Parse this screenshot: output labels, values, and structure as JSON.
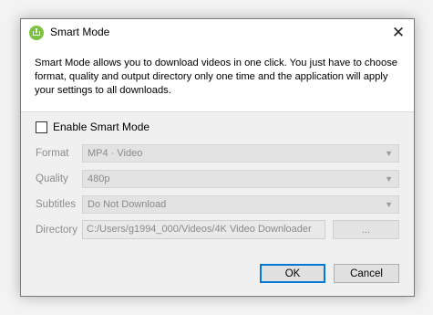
{
  "dialog": {
    "title": "Smart Mode",
    "close_glyph": "✕",
    "description": "Smart Mode allows you to download videos in one click. You just have to choose format, quality and output directory only one time and the application will apply your settings to all downloads."
  },
  "smart_mode": {
    "checkbox_label": "Enable Smart Mode",
    "checked": false
  },
  "fields": {
    "format": {
      "label": "Format",
      "value": "MP4 · Video"
    },
    "quality": {
      "label": "Quality",
      "value": "480p"
    },
    "subtitles": {
      "label": "Subtitles",
      "value": "Do Not Download"
    },
    "directory": {
      "label": "Directory",
      "value": "C:/Users/g1994_000/Videos/4K Video Downloader"
    }
  },
  "buttons": {
    "browse": "...",
    "ok": "OK",
    "cancel": "Cancel"
  },
  "colors": {
    "app_icon": "#7cc242",
    "default_button_border": "#0078d7",
    "disabled_text": "#8a8a8a"
  },
  "icons": {
    "app": "4k-video-downloader-logo-icon",
    "close": "close-icon",
    "dropdown": "chevron-down-icon"
  }
}
